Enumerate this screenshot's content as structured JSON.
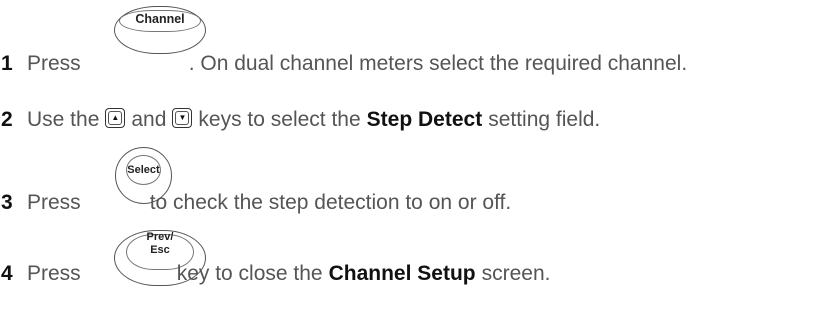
{
  "steps": [
    {
      "num": "1",
      "pre": "Press",
      "key": "Channel",
      "post": ". On dual channel meters select the required channel."
    },
    {
      "num": "2",
      "pre": "Use the",
      "and": "and",
      "mid": "keys to select the",
      "bold": "Step Detect",
      "post": "setting field."
    },
    {
      "num": "3",
      "pre": "Press",
      "key": "Select",
      "post": "to check the step detection to on or off."
    },
    {
      "num": "4",
      "pre": "Press",
      "key_line1": "Prev/",
      "key_line2": "Esc",
      "mid": "key to close the",
      "bold": "Channel Setup",
      "post": "screen."
    }
  ],
  "icons": {
    "up": "up-arrow-key-icon",
    "down": "down-arrow-key-icon"
  },
  "colors": {
    "body_text": "#555555",
    "step_number": "#111111"
  }
}
